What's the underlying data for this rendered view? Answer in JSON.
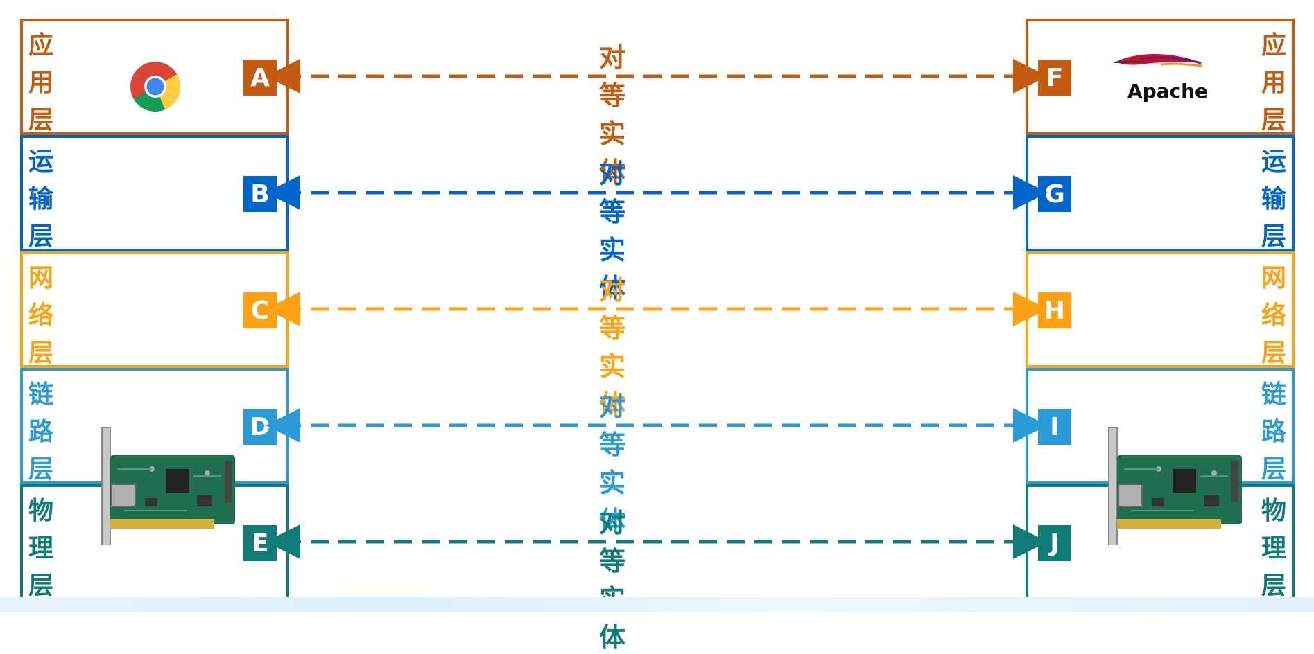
{
  "peer_label": "对等实体",
  "left_stack": [
    {
      "name": "应用层",
      "letter": "A",
      "color": "#c55a11"
    },
    {
      "name": "运输层",
      "letter": "B",
      "color": "#0066cc"
    },
    {
      "name": "网络层",
      "letter": "C",
      "color": "#ffa115"
    },
    {
      "name": "链路层",
      "letter": "D",
      "color": "#2b9ad8"
    },
    {
      "name": "物理层",
      "letter": "E",
      "color": "#107c78"
    }
  ],
  "right_stack": [
    {
      "name": "应用层",
      "letter": "F",
      "color": "#c55a11"
    },
    {
      "name": "运输层",
      "letter": "G",
      "color": "#0066cc"
    },
    {
      "name": "网络层",
      "letter": "H",
      "color": "#ffa115"
    },
    {
      "name": "链路层",
      "letter": "I",
      "color": "#2b9ad8"
    },
    {
      "name": "物理层",
      "letter": "J",
      "color": "#107c78"
    }
  ],
  "apache_logo_text": "Apache",
  "icons": {
    "browser": "chrome-icon",
    "server": "apache-feather-icon",
    "hardware": "network-card-icon"
  }
}
